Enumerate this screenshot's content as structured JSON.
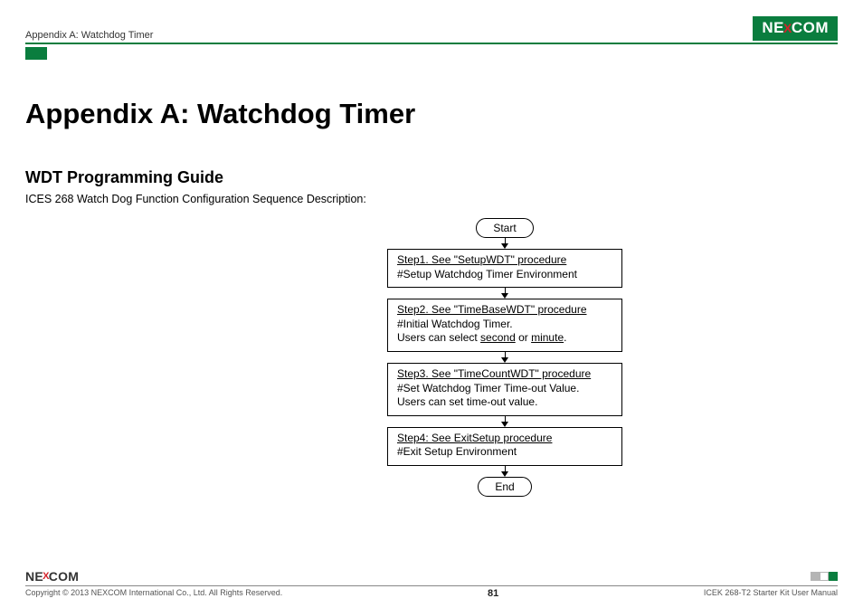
{
  "header": {
    "breadcrumb": "Appendix A: Watchdog Timer",
    "logo_text_pre": "NE",
    "logo_text_x": "X",
    "logo_text_post": "COM"
  },
  "title": "Appendix A: Watchdog Timer",
  "subtitle": "WDT Programming Guide",
  "description": "ICES 268 Watch Dog Function Configuration Sequence Description:",
  "flow": {
    "start": "Start",
    "end": "End",
    "steps": [
      {
        "title": "Step1. See \"SetupWDT\" procedure",
        "body": "#Setup Watchdog Timer Environment"
      },
      {
        "title": "Step2. See \"TimeBaseWDT\" procedure",
        "body_pre": "#Initial Watchdog Timer.\n Users can select ",
        "body_u1": "second",
        "body_mid": " or ",
        "body_u2": "minute",
        "body_post": "."
      },
      {
        "title": "Step3. See \"TimeCountWDT\" procedure",
        "body": "#Set Watchdog Timer Time-out Value.\nUsers can set time-out value."
      },
      {
        "title": "Step4: See ExitSetup procedure",
        "body": "#Exit Setup Environment"
      }
    ]
  },
  "footer": {
    "logo_pre": "NE",
    "logo_x": "X",
    "logo_post": "COM",
    "copyright": "Copyright © 2013 NEXCOM International Co., Ltd. All Rights Reserved.",
    "page": "81",
    "doc_title": "ICEK 268-T2 Starter Kit User Manual"
  }
}
